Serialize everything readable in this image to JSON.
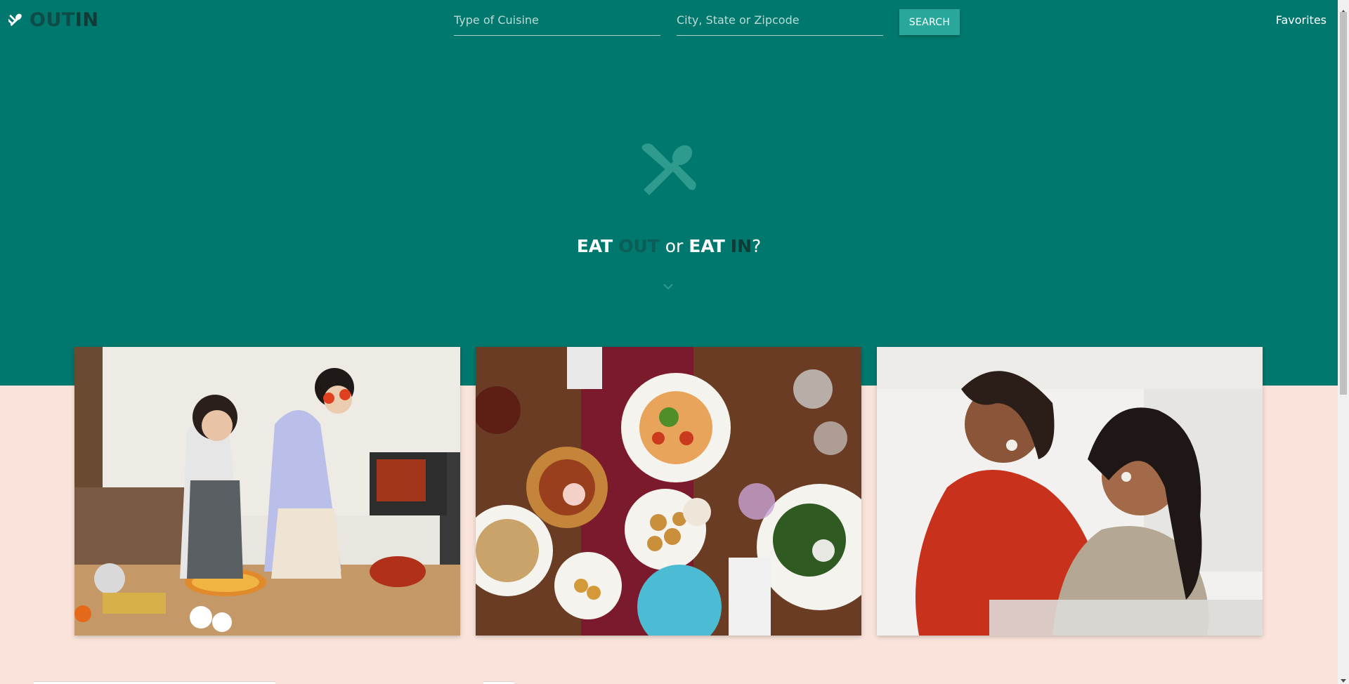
{
  "brand": {
    "name_out": "OUT",
    "name_in": "IN",
    "icon": "utensils-crossed-icon"
  },
  "search": {
    "cuisine_placeholder": "Type of Cuisine",
    "city_placeholder": "City, State or Zipcode",
    "button_label": "SEARCH"
  },
  "nav": {
    "favorites_label": "Favorites"
  },
  "hero": {
    "icon": "utensils-crossed-icon",
    "tagline": {
      "eat1": "EAT",
      "out": "OUT",
      "or": "or",
      "eat2": "EAT",
      "in": "IN",
      "qmark": "?"
    },
    "scroll_icon": "chevron-down-icon"
  },
  "cards": [
    {
      "name": "cooking-together-photo"
    },
    {
      "name": "table-dishes-photo"
    },
    {
      "name": "baking-family-photo"
    }
  ],
  "colors": {
    "teal": "#00786d",
    "peach": "#f9e3da",
    "button": "#28a79a",
    "logo_dark": "#0e4d47"
  }
}
